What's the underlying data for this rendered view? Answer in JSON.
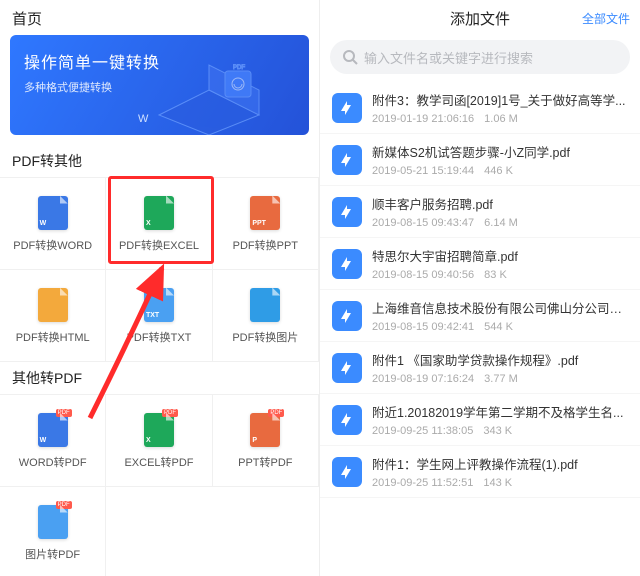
{
  "left": {
    "title": "首页",
    "banner": {
      "title": "操作简单一键转换",
      "subtitle": "多种格式便捷转换",
      "deco_w": "W"
    },
    "section1": "PDF转其他",
    "tiles1": [
      {
        "label": "PDF转换WORD",
        "tag": "W"
      },
      {
        "label": "PDF转换EXCEL",
        "tag": "X"
      },
      {
        "label": "PDF转换PPT",
        "tag": "PPT"
      },
      {
        "label": "PDF转换HTML",
        "tag": ""
      },
      {
        "label": "PDF转换TXT",
        "tag": "TXT"
      },
      {
        "label": "PDF转换图片",
        "tag": ""
      }
    ],
    "section2": "其他转PDF",
    "tiles2": [
      {
        "label": "WORD转PDF",
        "tag": "W",
        "badge": "PDF"
      },
      {
        "label": "EXCEL转PDF",
        "tag": "X",
        "badge": "PDF"
      },
      {
        "label": "PPT转PDF",
        "tag": "P",
        "badge": "PDF"
      },
      {
        "label": "图片转PDF",
        "tag": "",
        "badge": "PDF"
      }
    ],
    "annotation": {
      "highlight_index": 1
    }
  },
  "right": {
    "title": "添加文件",
    "all_label": "全部文件",
    "search_placeholder": "输入文件名或关键字进行搜索",
    "files": [
      {
        "name": "附件3：教学司函[2019]1号_关于做好高等学...",
        "time": "2019-01-19 21:06:16",
        "size": "1.06 M"
      },
      {
        "name": "新媒体S2机试答题步骤-小Z同学.pdf",
        "time": "2019-05-21 15:19:44",
        "size": "446 K"
      },
      {
        "name": "顺丰客户服务招聘.pdf",
        "time": "2019-08-15 09:43:47",
        "size": "6.14 M"
      },
      {
        "name": "特思尔大宇宙招聘简章.pdf",
        "time": "2019-08-15 09:40:56",
        "size": "83 K"
      },
      {
        "name": "上海维音信息技术股份有限公司佛山分公司20...",
        "time": "2019-08-15 09:42:41",
        "size": "544 K"
      },
      {
        "name": "附件1 《国家助学贷款操作规程》.pdf",
        "time": "2019-08-19 07:16:24",
        "size": "3.77 M"
      },
      {
        "name": "附近1.20182019学年第二学期不及格学生名...",
        "time": "2019-09-25 11:38:05",
        "size": "343 K"
      },
      {
        "name": "附件1：学生网上评教操作流程(1).pdf",
        "time": "2019-09-25 11:52:51",
        "size": "143 K"
      }
    ]
  },
  "colors": {
    "accent": "#3b8bff",
    "highlight": "#ff2b2b"
  }
}
